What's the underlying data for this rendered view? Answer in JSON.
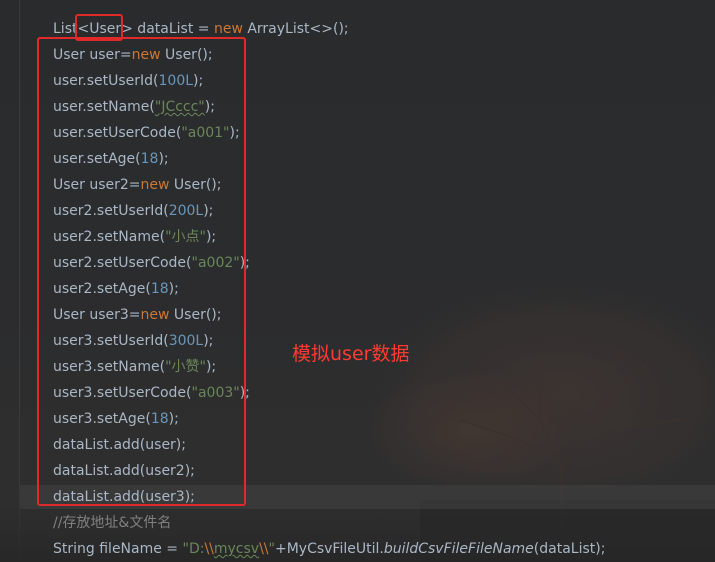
{
  "editor": {
    "lines": [
      [
        {
          "t": "List",
          "c": ""
        },
        {
          "t": "<User>",
          "c": ""
        },
        {
          "t": " dataList = ",
          "c": ""
        },
        {
          "t": "new",
          "c": "kw"
        },
        {
          "t": " ArrayList<>();",
          "c": ""
        }
      ],
      [
        {
          "t": "User user=",
          "c": ""
        },
        {
          "t": "new",
          "c": "kw"
        },
        {
          "t": " User();",
          "c": ""
        }
      ],
      [
        {
          "t": "user.setUserId(",
          "c": ""
        },
        {
          "t": "100L",
          "c": "num"
        },
        {
          "t": ");",
          "c": ""
        }
      ],
      [
        {
          "t": "user.setName(",
          "c": ""
        },
        {
          "t": "\"JCccc\"",
          "c": "str uline"
        },
        {
          "t": ");",
          "c": ""
        }
      ],
      [
        {
          "t": "user.setUserCode(",
          "c": ""
        },
        {
          "t": "\"a001\"",
          "c": "str"
        },
        {
          "t": ");",
          "c": ""
        }
      ],
      [
        {
          "t": "user.setAge(",
          "c": ""
        },
        {
          "t": "18",
          "c": "num"
        },
        {
          "t": ");",
          "c": ""
        }
      ],
      [
        {
          "t": "User user2=",
          "c": ""
        },
        {
          "t": "new",
          "c": "kw"
        },
        {
          "t": " User();",
          "c": ""
        }
      ],
      [
        {
          "t": "user2.setUserId(",
          "c": ""
        },
        {
          "t": "200L",
          "c": "num"
        },
        {
          "t": ");",
          "c": ""
        }
      ],
      [
        {
          "t": "user2.setName(",
          "c": ""
        },
        {
          "t": "\"小点\"",
          "c": "str"
        },
        {
          "t": ");",
          "c": ""
        }
      ],
      [
        {
          "t": "user2.setUserCode(",
          "c": ""
        },
        {
          "t": "\"a002\"",
          "c": "str"
        },
        {
          "t": ");",
          "c": ""
        }
      ],
      [
        {
          "t": "user2.setAge(",
          "c": ""
        },
        {
          "t": "18",
          "c": "num"
        },
        {
          "t": ");",
          "c": ""
        }
      ],
      [
        {
          "t": "User user3=",
          "c": ""
        },
        {
          "t": "new",
          "c": "kw"
        },
        {
          "t": " User();",
          "c": ""
        }
      ],
      [
        {
          "t": "user3.setUserId(",
          "c": ""
        },
        {
          "t": "300L",
          "c": "num"
        },
        {
          "t": ");",
          "c": ""
        }
      ],
      [
        {
          "t": "user3.setName(",
          "c": ""
        },
        {
          "t": "\"小赞\"",
          "c": "str"
        },
        {
          "t": ");",
          "c": ""
        }
      ],
      [
        {
          "t": "user3.setUserCode(",
          "c": ""
        },
        {
          "t": "\"a003\"",
          "c": "str"
        },
        {
          "t": ");",
          "c": ""
        }
      ],
      [
        {
          "t": "user3.setAge(",
          "c": ""
        },
        {
          "t": "18",
          "c": "num"
        },
        {
          "t": ");",
          "c": ""
        }
      ],
      [
        {
          "t": "dataList.add(user);",
          "c": ""
        }
      ],
      [
        {
          "t": "dataList.add(user2);",
          "c": ""
        }
      ],
      [
        {
          "t": "dataList.add(user3);",
          "c": ""
        }
      ],
      [
        {
          "t": "//存放地址&文件名",
          "c": "cmt"
        }
      ],
      [
        {
          "t": "String fileName = ",
          "c": ""
        },
        {
          "t": "\"D:",
          "c": "str"
        },
        {
          "t": "\\\\",
          "c": "kw"
        },
        {
          "t": "mycsv",
          "c": "str uline"
        },
        {
          "t": "\\\\",
          "c": "kw"
        },
        {
          "t": "\"",
          "c": "str"
        },
        {
          "t": "+MyCsvFileUtil.",
          "c": ""
        },
        {
          "t": "buildCsvFileFileName",
          "c": "ital"
        },
        {
          "t": "(dataList);",
          "c": ""
        }
      ]
    ]
  },
  "annotation": {
    "label": "模拟user数据"
  },
  "colors": {
    "keyword": "#cc7832",
    "number": "#6897bb",
    "string": "#6a8759",
    "comment": "#808080",
    "default": "#a9b7c6",
    "annotation": "#ff3b2f",
    "box": "#e02a2a"
  }
}
